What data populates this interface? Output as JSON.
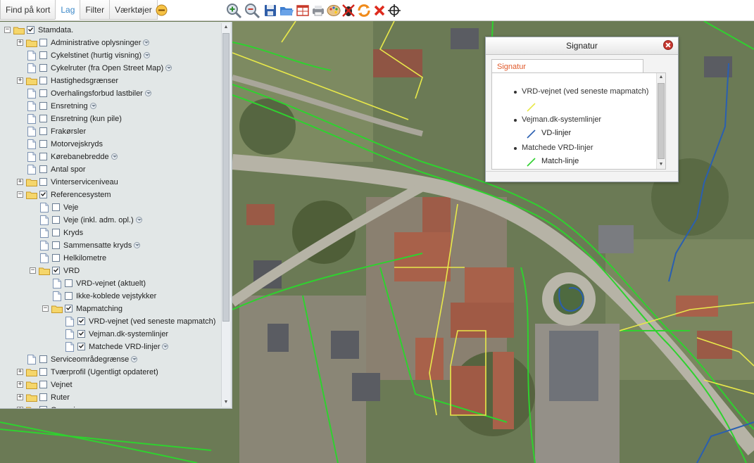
{
  "tabs": [
    {
      "label": "Find på kort",
      "active": false
    },
    {
      "label": "Lag",
      "active": true
    },
    {
      "label": "Filter",
      "active": false
    },
    {
      "label": "Værktøjer",
      "active": false
    }
  ],
  "toolbar_icons": [
    "collapse-icon",
    "zoom-in-icon",
    "zoom-out-icon",
    "save-icon",
    "open-folder-icon",
    "grid-icon",
    "print-icon",
    "palette-icon",
    "bug-off-icon",
    "refresh-icon",
    "close-x-icon",
    "crosshair-icon"
  ],
  "tree": [
    {
      "label": "Stamdata.",
      "level": 0,
      "expander": "-",
      "type": "folder",
      "checked": true,
      "info": false
    },
    {
      "label": "Administrative oplysninger",
      "level": 1,
      "expander": "+",
      "type": "folder",
      "checked": false,
      "info": true
    },
    {
      "label": "Cykelstinet (hurtig visning)",
      "level": 1,
      "expander": "",
      "type": "page",
      "checked": false,
      "info": true
    },
    {
      "label": "Cykelruter (fra Open Street Map)",
      "level": 1,
      "expander": "",
      "type": "page",
      "checked": false,
      "info": true
    },
    {
      "label": "Hastighedsgrænser",
      "level": 1,
      "expander": "+",
      "type": "folder",
      "checked": false,
      "info": false
    },
    {
      "label": "Overhalingsforbud lastbiler",
      "level": 1,
      "expander": "",
      "type": "page",
      "checked": false,
      "info": true
    },
    {
      "label": "Ensretning",
      "level": 1,
      "expander": "",
      "type": "page",
      "checked": false,
      "info": true
    },
    {
      "label": "Ensretning (kun pile)",
      "level": 1,
      "expander": "",
      "type": "page",
      "checked": false,
      "info": false
    },
    {
      "label": "Frakørsler",
      "level": 1,
      "expander": "",
      "type": "page",
      "checked": false,
      "info": false
    },
    {
      "label": "Motorvejskryds",
      "level": 1,
      "expander": "",
      "type": "page",
      "checked": false,
      "info": false
    },
    {
      "label": "Kørebanebredde",
      "level": 1,
      "expander": "",
      "type": "page",
      "checked": false,
      "info": true
    },
    {
      "label": "Antal spor",
      "level": 1,
      "expander": "",
      "type": "page",
      "checked": false,
      "info": false
    },
    {
      "label": "Vinterserviceniveau",
      "level": 1,
      "expander": "+",
      "type": "folder",
      "checked": false,
      "info": false
    },
    {
      "label": "Referencesystem",
      "level": 1,
      "expander": "-",
      "type": "folder",
      "checked": true,
      "info": false
    },
    {
      "label": "Veje",
      "level": 2,
      "expander": "",
      "type": "page",
      "checked": false,
      "info": false
    },
    {
      "label": "Veje (inkl. adm. opl.)",
      "level": 2,
      "expander": "",
      "type": "page",
      "checked": false,
      "info": true
    },
    {
      "label": "Kryds",
      "level": 2,
      "expander": "",
      "type": "page",
      "checked": false,
      "info": false
    },
    {
      "label": "Sammensatte kryds",
      "level": 2,
      "expander": "",
      "type": "page",
      "checked": false,
      "info": true
    },
    {
      "label": "Helkilometre",
      "level": 2,
      "expander": "",
      "type": "page",
      "checked": false,
      "info": false
    },
    {
      "label": "VRD",
      "level": 2,
      "expander": "-",
      "type": "folder",
      "checked": true,
      "info": false
    },
    {
      "label": "VRD-vejnet (aktuelt)",
      "level": 3,
      "expander": "",
      "type": "page",
      "checked": false,
      "info": false
    },
    {
      "label": "Ikke-koblede vejstykker",
      "level": 3,
      "expander": "",
      "type": "page",
      "checked": false,
      "info": false
    },
    {
      "label": "Mapmatching",
      "level": 3,
      "expander": "-",
      "type": "folder",
      "checked": true,
      "info": false
    },
    {
      "label": "VRD-vejnet (ved seneste mapmatch)",
      "level": 4,
      "expander": "",
      "type": "page",
      "checked": true,
      "info": false
    },
    {
      "label": "Vejman.dk-systemlinjer",
      "level": 4,
      "expander": "",
      "type": "page",
      "checked": true,
      "info": false
    },
    {
      "label": "Matchede VRD-linjer",
      "level": 4,
      "expander": "",
      "type": "page",
      "checked": true,
      "info": true
    },
    {
      "label": "Serviceområdegrænse",
      "level": 1,
      "expander": "",
      "type": "page",
      "checked": false,
      "info": true
    },
    {
      "label": "Tværprofil (Ugentligt opdateret)",
      "level": 1,
      "expander": "+",
      "type": "folder",
      "checked": false,
      "info": false
    },
    {
      "label": "Vejnet",
      "level": 1,
      "expander": "+",
      "type": "folder",
      "checked": false,
      "info": false
    },
    {
      "label": "Ruter",
      "level": 1,
      "expander": "+",
      "type": "folder",
      "checked": false,
      "info": false
    },
    {
      "label": "Genveje",
      "level": 1,
      "expander": "+",
      "type": "folder",
      "checked": false,
      "info": false
    }
  ],
  "popup": {
    "title": "Signatur",
    "tab_label": "Signatur",
    "legend": [
      {
        "title": "VRD-vejnet (ved seneste mapmatch)",
        "item": "",
        "color": "#e8e84a"
      },
      {
        "title": "Vejman.dk-systemlinjer",
        "item": "VD-linjer",
        "color": "#2a5fb0"
      },
      {
        "title": "Matchede VRD-linjer",
        "item": "Match-linje",
        "color": "#2fd12f"
      }
    ]
  },
  "colors": {
    "accent": "#3a87c8",
    "vrd_line": "#e8e84a",
    "vd_line": "#2a5fb0",
    "match_line": "#2fd12f"
  }
}
